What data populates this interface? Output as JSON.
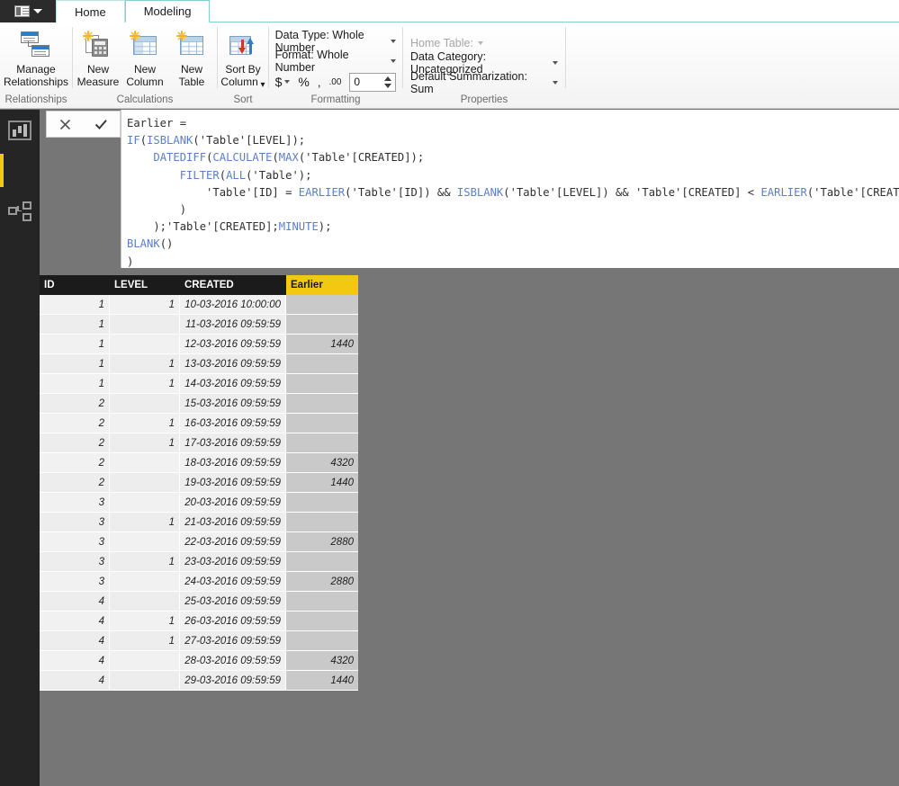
{
  "window": {
    "file_menu_icon": "file-menu-icon",
    "tabs": [
      {
        "label": "Home",
        "active": false
      },
      {
        "label": "Modeling",
        "active": true
      }
    ]
  },
  "ribbon": {
    "groups": [
      {
        "name": "relationships",
        "label": "Relationships",
        "buttons": [
          {
            "name": "manage-relationships",
            "line1": "Manage",
            "line2": "Relationships",
            "icon": "relationships-icon"
          }
        ]
      },
      {
        "name": "calculations",
        "label": "Calculations",
        "buttons": [
          {
            "name": "new-measure",
            "line1": "New",
            "line2": "Measure",
            "icon": "new-measure-icon"
          },
          {
            "name": "new-column",
            "line1": "New",
            "line2": "Column",
            "icon": "new-column-icon"
          },
          {
            "name": "new-table",
            "line1": "New",
            "line2": "Table",
            "icon": "new-table-icon"
          }
        ]
      },
      {
        "name": "sort",
        "label": "Sort",
        "buttons": [
          {
            "name": "sort-by-column",
            "line1": "Sort By",
            "line2": "Column",
            "icon": "sort-by-column-icon",
            "has_caret": true
          }
        ]
      },
      {
        "name": "formatting",
        "label": "Formatting",
        "data_type": "Data Type: Whole Number",
        "format": "Format: Whole Number",
        "currency_symbol": "$",
        "percent_symbol": "%",
        "thousands_symbol": ",",
        "decimal_symbol": ".00",
        "decimal_places": "0"
      },
      {
        "name": "properties",
        "label": "Properties",
        "home_table": "Home Table:",
        "data_category": "Data Category: Uncategorized",
        "default_summarization": "Default Summarization: Sum"
      }
    ]
  },
  "leftnav": {
    "items": [
      {
        "name": "report-view",
        "icon": "bar-chart-icon",
        "active": false
      },
      {
        "name": "data-view",
        "icon": "table-grid-icon",
        "active": true
      },
      {
        "name": "relationship-view",
        "icon": "relationships-icon",
        "active": false
      }
    ]
  },
  "formula_bar": {
    "cancel_icon": "close-icon",
    "commit_icon": "checkmark-icon",
    "lines": [
      [
        {
          "t": "Earlier =",
          "c": "plain"
        }
      ],
      [
        {
          "t": "IF",
          "c": "fn"
        },
        {
          "t": "(",
          "c": "plain"
        },
        {
          "t": "ISBLANK",
          "c": "fn"
        },
        {
          "t": "('Table'[LEVEL]);",
          "c": "plain"
        }
      ],
      [
        {
          "t": "    ",
          "c": "plain"
        },
        {
          "t": "DATEDIFF",
          "c": "fn"
        },
        {
          "t": "(",
          "c": "plain"
        },
        {
          "t": "CALCULATE",
          "c": "fn"
        },
        {
          "t": "(",
          "c": "plain"
        },
        {
          "t": "MAX",
          "c": "fn"
        },
        {
          "t": "('Table'[CREATED]);",
          "c": "plain"
        }
      ],
      [
        {
          "t": "        ",
          "c": "plain"
        },
        {
          "t": "FILTER",
          "c": "fn"
        },
        {
          "t": "(",
          "c": "plain"
        },
        {
          "t": "ALL",
          "c": "fn"
        },
        {
          "t": "('Table');",
          "c": "plain"
        }
      ],
      [
        {
          "t": "            'Table'[ID] = ",
          "c": "plain"
        },
        {
          "t": "EARLIER",
          "c": "fn"
        },
        {
          "t": "('Table'[ID]) && ",
          "c": "plain"
        },
        {
          "t": "ISBLANK",
          "c": "fn"
        },
        {
          "t": "('Table'[LEVEL]) && 'Table'[CREATED] < ",
          "c": "plain"
        },
        {
          "t": "EARLIER",
          "c": "fn"
        },
        {
          "t": "('Table'[CREATED])",
          "c": "plain"
        }
      ],
      [
        {
          "t": "        )",
          "c": "plain"
        }
      ],
      [
        {
          "t": "    );'Table'[CREATED];",
          "c": "plain"
        },
        {
          "t": "MINUTE",
          "c": "fn"
        },
        {
          "t": ");",
          "c": "plain"
        }
      ],
      [
        {
          "t": "BLANK",
          "c": "fn"
        },
        {
          "t": "()",
          "c": "plain"
        }
      ],
      [
        {
          "t": ")",
          "c": "plain"
        }
      ]
    ]
  },
  "data_grid": {
    "columns": [
      {
        "key": "id",
        "label": "ID",
        "calculated": false
      },
      {
        "key": "level",
        "label": "LEVEL",
        "calculated": false
      },
      {
        "key": "created",
        "label": "CREATED",
        "calculated": false
      },
      {
        "key": "earlier",
        "label": "Earlier",
        "calculated": true
      }
    ],
    "rows": [
      {
        "id": "1",
        "level": "1",
        "created": "10-03-2016 10:00:00",
        "earlier": ""
      },
      {
        "id": "1",
        "level": "",
        "created": "11-03-2016 09:59:59",
        "earlier": ""
      },
      {
        "id": "1",
        "level": "",
        "created": "12-03-2016 09:59:59",
        "earlier": "1440"
      },
      {
        "id": "1",
        "level": "1",
        "created": "13-03-2016 09:59:59",
        "earlier": ""
      },
      {
        "id": "1",
        "level": "1",
        "created": "14-03-2016 09:59:59",
        "earlier": ""
      },
      {
        "id": "2",
        "level": "",
        "created": "15-03-2016 09:59:59",
        "earlier": ""
      },
      {
        "id": "2",
        "level": "1",
        "created": "16-03-2016 09:59:59",
        "earlier": ""
      },
      {
        "id": "2",
        "level": "1",
        "created": "17-03-2016 09:59:59",
        "earlier": ""
      },
      {
        "id": "2",
        "level": "",
        "created": "18-03-2016 09:59:59",
        "earlier": "4320"
      },
      {
        "id": "2",
        "level": "",
        "created": "19-03-2016 09:59:59",
        "earlier": "1440"
      },
      {
        "id": "3",
        "level": "",
        "created": "20-03-2016 09:59:59",
        "earlier": ""
      },
      {
        "id": "3",
        "level": "1",
        "created": "21-03-2016 09:59:59",
        "earlier": ""
      },
      {
        "id": "3",
        "level": "",
        "created": "22-03-2016 09:59:59",
        "earlier": "2880"
      },
      {
        "id": "3",
        "level": "1",
        "created": "23-03-2016 09:59:59",
        "earlier": ""
      },
      {
        "id": "3",
        "level": "",
        "created": "24-03-2016 09:59:59",
        "earlier": "2880"
      },
      {
        "id": "4",
        "level": "",
        "created": "25-03-2016 09:59:59",
        "earlier": ""
      },
      {
        "id": "4",
        "level": "1",
        "created": "26-03-2016 09:59:59",
        "earlier": ""
      },
      {
        "id": "4",
        "level": "1",
        "created": "27-03-2016 09:59:59",
        "earlier": ""
      },
      {
        "id": "4",
        "level": "",
        "created": "28-03-2016 09:59:59",
        "earlier": "4320"
      },
      {
        "id": "4",
        "level": "",
        "created": "29-03-2016 09:59:59",
        "earlier": "1440"
      }
    ]
  },
  "colors": {
    "accent_yellow": "#F2C811",
    "canvas_gray": "#767676",
    "nav_dark": "#252526",
    "header_dark": "#1B1B1B",
    "calc_cell_gray": "#C9C9C9",
    "code_blue": "#5B7FC7"
  }
}
